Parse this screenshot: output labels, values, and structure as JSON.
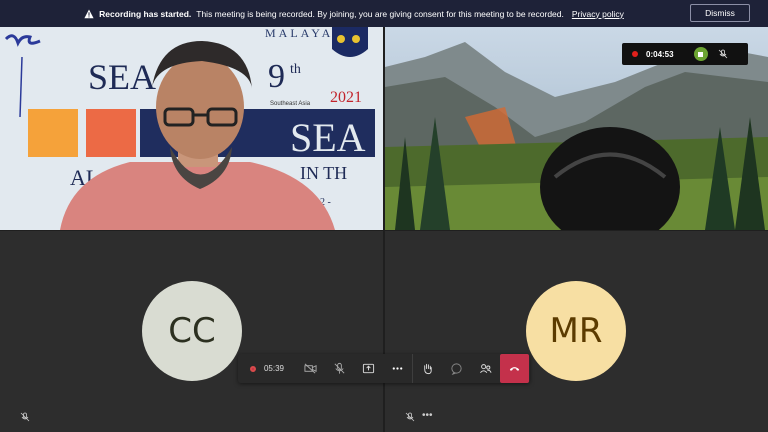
{
  "banner": {
    "title": "Recording has started.",
    "message": "This meeting is being recorded. By joining, you are giving consent for this meeting to be recorded.",
    "link": "Privacy policy",
    "dismiss": "Dismiss"
  },
  "participants": [
    {
      "initials": "CC"
    },
    {
      "initials": "MR"
    }
  ],
  "recording_indicator": {
    "time": "0:04:53"
  },
  "toolbar": {
    "timer": "05:39"
  },
  "slide_text": {
    "malaya": "MALAYA",
    "num": "9",
    "sup": "th",
    "sea": "SEA",
    "year": "2021",
    "asia": "Southeast Asia",
    "in_th": "IN TH",
    "al": "AL",
    "dash": "2 -"
  },
  "colors": {
    "accent_record": "#c4314b",
    "banner_bg": "#1e2238",
    "stop_green": "#6ca432"
  }
}
